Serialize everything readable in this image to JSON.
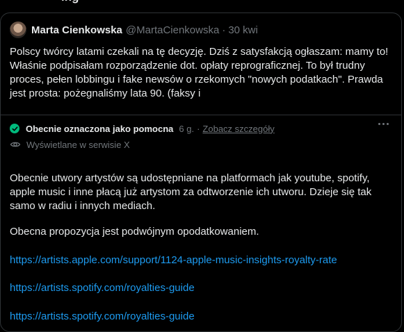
{
  "top_fragment": "ing",
  "quote": {
    "author_name": "Marta Cienkowska",
    "author_handle": "@MartaCienkowska",
    "separator": "·",
    "time": "30 kwi",
    "text": "Polscy twórcy latami czekali na tę decyzję. Dziś z satysfakcją ogłaszam: mamy to! Właśnie podpisałam rozporządzenie dot. opłaty reprograficznej. To był trudny proces, pełen lobbingu i fake newsów o rzekomych \"nowych podatkach\". Prawda jest prosta: pożegnaliśmy lata 90. (faksy i"
  },
  "note": {
    "status_label": "Obecnie oznaczona jako pomocna",
    "age": "6 g.",
    "separator": "·",
    "details_link": "Zobacz szczegóły",
    "visibility": "Wyświetlane w serwisie X",
    "paragraph_1": "Obecnie utwory artystów są udostępniane na platformach jak youtube, spotify, apple music i inne płacą już artystom za odtworzenie ich utworu. Dzieje się tak samo w radiu i innych mediach.",
    "paragraph_2": "Obecna propozycja jest podwójnym opodatkowaniem.",
    "links": [
      "https://artists.apple.com/support/1124-apple-music-insights-royalty-rate",
      "https://artists.spotify.com/royalties-guide",
      "https://artists.spotify.com/royalties-guide"
    ]
  },
  "colors": {
    "background": "#000000",
    "text": "#e7e9ea",
    "muted": "#71767b",
    "link": "#1d9bf0",
    "helpful_green": "#00ba7c",
    "border": "#2f3336"
  },
  "icons": [
    "avatar",
    "check-icon",
    "more-icon",
    "eye-icon"
  ]
}
